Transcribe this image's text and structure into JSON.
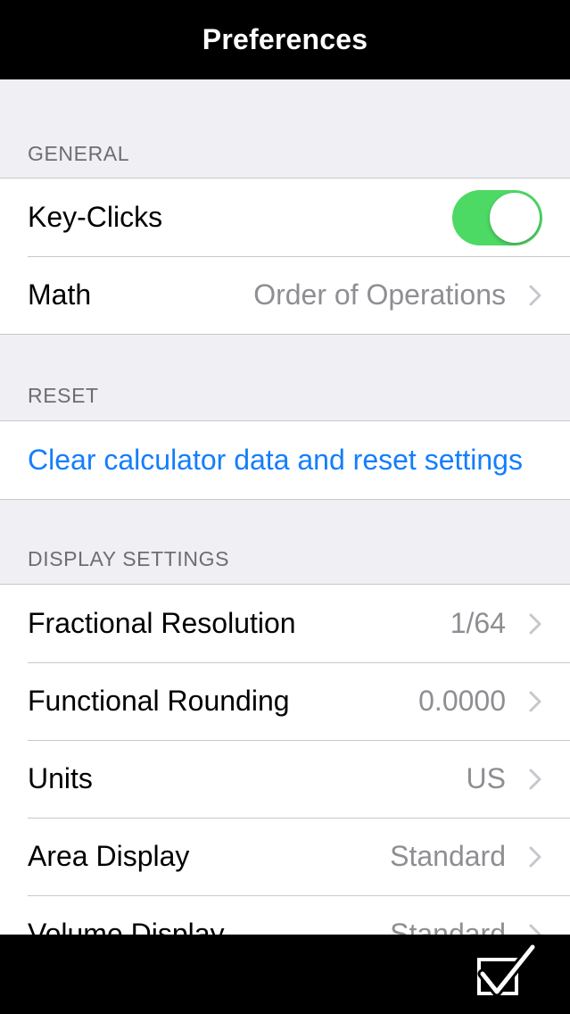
{
  "navbar": {
    "title": "Preferences"
  },
  "sections": {
    "general": {
      "header": "GENERAL",
      "key_clicks": {
        "label": "Key-Clicks",
        "on": true
      },
      "math": {
        "label": "Math",
        "value": "Order of Operations"
      }
    },
    "reset": {
      "header": "RESET",
      "clear_label": "Clear calculator data and reset settings"
    },
    "display": {
      "header": "DISPLAY SETTINGS",
      "rows": [
        {
          "label": "Fractional Resolution",
          "value": "1/64"
        },
        {
          "label": "Functional Rounding",
          "value": "0.0000"
        },
        {
          "label": "Units",
          "value": "US"
        },
        {
          "label": "Area Display",
          "value": "Standard"
        },
        {
          "label": "Volume Display",
          "value": "Standard"
        }
      ]
    }
  },
  "toolbar": {
    "done_icon": "checkmark-box-icon"
  },
  "colors": {
    "toggle_on": "#4cd964",
    "link": "#147efb",
    "bar": "#000000",
    "background": "#efeff4"
  }
}
